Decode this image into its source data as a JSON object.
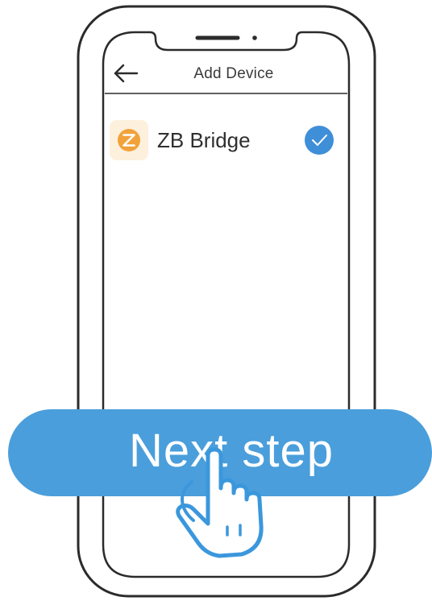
{
  "header": {
    "title": "Add Device",
    "back_icon": "back-arrow-icon"
  },
  "device": {
    "name": "ZB Bridge",
    "icon": "zigbee-icon",
    "selected": true,
    "check_icon": "checkmark-icon"
  },
  "action": {
    "next_label": "Next step",
    "pointer_icon": "hand-pointer-icon"
  },
  "colors": {
    "accent_blue": "#4a9edb",
    "check_blue": "#3f8ed8",
    "device_icon_orange": "#f2a23a",
    "device_icon_bg": "#fdf0dd",
    "outline": "#2b2b2b"
  }
}
